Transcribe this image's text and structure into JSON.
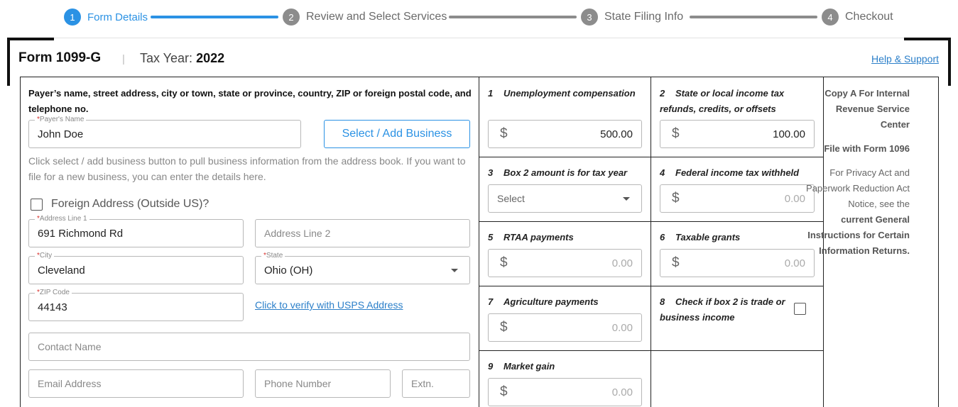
{
  "stepper": {
    "steps": [
      {
        "num": "1",
        "label": "Form Details"
      },
      {
        "num": "2",
        "label": "Review and Select Services"
      },
      {
        "num": "3",
        "label": "State Filing Info"
      },
      {
        "num": "4",
        "label": "Checkout"
      }
    ],
    "active_index": 0
  },
  "header": {
    "form_title": "Form 1099-G",
    "separator": "|",
    "tax_year_label": "Tax Year:",
    "tax_year_value": "2022",
    "help_link": "Help & Support"
  },
  "payer": {
    "heading": "Payer’s name, street address, city or town, state or province, country, ZIP or foreign postal code, and telephone no.",
    "name_label": "Payer's Name",
    "name_value": "John Doe",
    "select_button": "Select / Add Business",
    "hint": "Click select / add business button to pull business information from the address book. If you want to file for a new business, you can enter the details here.",
    "foreign_label": "Foreign Address (Outside US)?",
    "address1_label": "Address Line 1",
    "address1_value": "691 Richmond Rd",
    "address2_placeholder": "Address Line 2",
    "city_label": "City",
    "city_value": "Cleveland",
    "state_label": "State",
    "state_value": "Ohio (OH)",
    "zip_label": "ZIP Code",
    "zip_value": "44143",
    "usps_link": "Click to verify with USPS Address",
    "contact_placeholder": "Contact Name",
    "email_placeholder": "Email Address",
    "phone_placeholder": "Phone Number",
    "ext_placeholder": "Extn.",
    "required_mark": "*"
  },
  "boxes": {
    "currency": "$",
    "b1": {
      "num": "1",
      "label": "Unemployment compensation",
      "value": "500.00"
    },
    "b2": {
      "num": "2",
      "label": "State or local income tax refunds, credits, or offsets",
      "value": "100.00"
    },
    "b3": {
      "num": "3",
      "label": "Box 2 amount is for tax year",
      "select": "Select"
    },
    "b4": {
      "num": "4",
      "label": "Federal income tax withheld",
      "value": "0.00"
    },
    "b5": {
      "num": "5",
      "label": "RTAA payments",
      "value": "0.00"
    },
    "b6": {
      "num": "6",
      "label": "Taxable grants",
      "value": "0.00"
    },
    "b7": {
      "num": "7",
      "label": "Agriculture payments",
      "value": "0.00"
    },
    "b8": {
      "num": "8",
      "label": "Check if box 2 is trade or business income"
    },
    "b9": {
      "num": "9",
      "label": "Market gain",
      "value": "0.00"
    }
  },
  "copy": {
    "line1": "Copy A For Internal Revenue Service Center",
    "line2": "File with Form 1096",
    "line3": "For Privacy Act and Paperwork Reduction Act Notice, see the",
    "line4": "current General Instructions for Certain Information Returns."
  }
}
